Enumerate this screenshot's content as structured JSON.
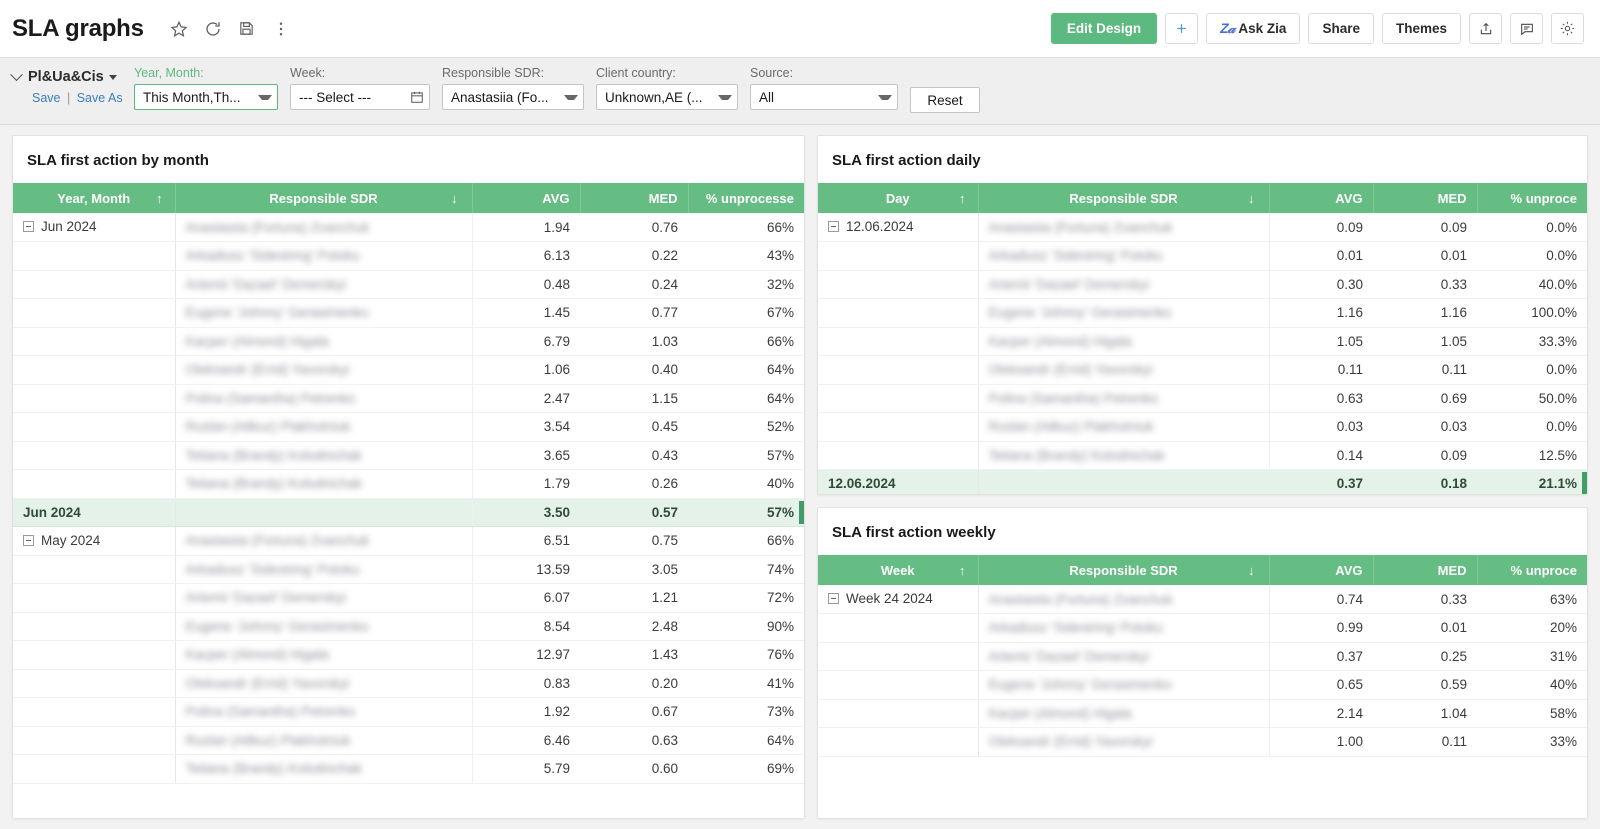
{
  "header": {
    "title": "SLA graphs",
    "title_icons": [
      {
        "name": "favorite-star-icon",
        "glyph": "star"
      },
      {
        "name": "refresh-icon",
        "glyph": "refresh"
      },
      {
        "name": "save-disk-icon",
        "glyph": "disk"
      },
      {
        "name": "more-options-icon",
        "glyph": "kebab"
      }
    ],
    "buttons": [
      {
        "name": "edit-design-button",
        "label": "Edit Design",
        "style": "primary"
      },
      {
        "name": "add-button",
        "label": "+",
        "style": "icon"
      },
      {
        "name": "ask-zia-button",
        "label": "Ask Zia",
        "style": "zia"
      },
      {
        "name": "share-button",
        "label": "Share",
        "style": "default"
      },
      {
        "name": "themes-button",
        "label": "Themes",
        "style": "default"
      },
      {
        "name": "export-button",
        "label": "",
        "style": "icon"
      },
      {
        "name": "comment-button",
        "label": "",
        "style": "icon"
      },
      {
        "name": "settings-button",
        "label": "",
        "style": "icon"
      }
    ]
  },
  "filterbar": {
    "view_name": "Pl&Ua&Cis",
    "save_label": "Save",
    "save_as_label": "Save As",
    "reset_label": "Reset",
    "filters": [
      {
        "name": "year-month",
        "label": "Year, Month:",
        "value": "This Month,Th...",
        "control": "select",
        "active": true
      },
      {
        "name": "week",
        "label": "Week:",
        "value": "--- Select ---",
        "control": "date",
        "active": false
      },
      {
        "name": "responsible-sdr",
        "label": "Responsible SDR:",
        "value": "Anastasiia (Fo...",
        "control": "select",
        "active": false
      },
      {
        "name": "client-country",
        "label": "Client country:",
        "value": "Unknown,AE (...",
        "control": "select",
        "active": false
      },
      {
        "name": "source",
        "label": "Source:",
        "value": "All",
        "control": "select",
        "active": false
      }
    ]
  },
  "colors": {
    "header_green": "#65bd83",
    "primary_green": "#5cb97f",
    "summary_row": "#e4f2e9",
    "summary_bar": "#3f9e63",
    "link_blue": "#3a7ec0",
    "canvas": "#f2f2f2"
  },
  "widgets": {
    "month": {
      "title": "SLA first action by month",
      "columns": [
        {
          "name": "year-month",
          "label": "Year, Month",
          "sort": "↑"
        },
        {
          "name": "responsible-sdr",
          "label": "Responsible SDR",
          "sort": "↓"
        },
        {
          "name": "avg",
          "label": "AVG"
        },
        {
          "name": "med",
          "label": "MED"
        },
        {
          "name": "pct-unprocessed",
          "label": "% unprocesse"
        }
      ],
      "groups": [
        {
          "label": "Jun 2024",
          "rows": [
            {
              "sdr": "Anastasiia (Fortuna) Zvanchuk",
              "avg": "1.94",
              "med": "0.76",
              "pct": "66%"
            },
            {
              "sdr": "Arkadiusz 'Sidestring' Potoku",
              "avg": "6.13",
              "med": "0.22",
              "pct": "43%"
            },
            {
              "sdr": "Artemii 'Dazael' Demerskyi",
              "avg": "0.48",
              "med": "0.24",
              "pct": "32%"
            },
            {
              "sdr": "Eugene 'Johnny' Gerasimenko",
              "avg": "1.45",
              "med": "0.77",
              "pct": "67%"
            },
            {
              "sdr": "Kacper (Almond) Higala",
              "avg": "6.79",
              "med": "1.03",
              "pct": "66%"
            },
            {
              "sdr": "Oleksandr (Errid) Yavorskyi",
              "avg": "1.06",
              "med": "0.40",
              "pct": "64%"
            },
            {
              "sdr": "Polina (Samantha) Petrenko",
              "avg": "2.47",
              "med": "1.15",
              "pct": "64%"
            },
            {
              "sdr": "Ruslan (Atlkuz) Plakhotniuk",
              "avg": "3.54",
              "med": "0.45",
              "pct": "52%"
            },
            {
              "sdr": "Tetiana (Brandy) Kolodnichak",
              "avg": "3.65",
              "med": "0.43",
              "pct": "57%"
            },
            {
              "sdr": "Tetiana (Brandy) Kolodnichak",
              "avg": "1.79",
              "med": "0.26",
              "pct": "40%"
            }
          ],
          "summary": {
            "label": "Jun 2024",
            "avg": "3.50",
            "med": "0.57",
            "pct": "57%"
          }
        },
        {
          "label": "May 2024",
          "rows": [
            {
              "sdr": "Anastasiia (Fortuna) Zvanchuk",
              "avg": "6.51",
              "med": "0.75",
              "pct": "66%"
            },
            {
              "sdr": "Arkadiusz 'Sidestring' Potoku",
              "avg": "13.59",
              "med": "3.05",
              "pct": "74%"
            },
            {
              "sdr": "Artemii 'Dazael' Demerskyi",
              "avg": "6.07",
              "med": "1.21",
              "pct": "72%"
            },
            {
              "sdr": "Eugene 'Johnny' Gerasimenko",
              "avg": "8.54",
              "med": "2.48",
              "pct": "90%"
            },
            {
              "sdr": "Kacper (Almond) Higala",
              "avg": "12.97",
              "med": "1.43",
              "pct": "76%"
            },
            {
              "sdr": "Oleksandr (Errid) Yavorskyi",
              "avg": "0.83",
              "med": "0.20",
              "pct": "41%"
            },
            {
              "sdr": "Polina (Samantha) Petrenko",
              "avg": "1.92",
              "med": "0.67",
              "pct": "73%"
            },
            {
              "sdr": "Ruslan (Atlkuz) Plakhotniuk",
              "avg": "6.46",
              "med": "0.63",
              "pct": "64%"
            },
            {
              "sdr": "Tetiana (Brandy) Kolodnichak",
              "avg": "5.79",
              "med": "0.60",
              "pct": "69%"
            }
          ],
          "summary": null
        }
      ]
    },
    "daily": {
      "title": "SLA first action daily",
      "columns": [
        {
          "name": "day",
          "label": "Day",
          "sort": "↑"
        },
        {
          "name": "responsible-sdr",
          "label": "Responsible SDR",
          "sort": "↓"
        },
        {
          "name": "avg",
          "label": "AVG"
        },
        {
          "name": "med",
          "label": "MED"
        },
        {
          "name": "pct-unprocessed",
          "label": "% unproce"
        }
      ],
      "groups": [
        {
          "label": "12.06.2024",
          "rows": [
            {
              "sdr": "Anastasiia (Fortuna) Zvanchuk",
              "avg": "0.09",
              "med": "0.09",
              "pct": "0.0%"
            },
            {
              "sdr": "Arkadiusz 'Sidestring' Potoku",
              "avg": "0.01",
              "med": "0.01",
              "pct": "0.0%"
            },
            {
              "sdr": "Artemii 'Dazael' Demerskyi",
              "avg": "0.30",
              "med": "0.33",
              "pct": "40.0%"
            },
            {
              "sdr": "Eugene 'Johnny' Gerasimenko",
              "avg": "1.16",
              "med": "1.16",
              "pct": "100.0%"
            },
            {
              "sdr": "Kacper (Almond) Higala",
              "avg": "1.05",
              "med": "1.05",
              "pct": "33.3%"
            },
            {
              "sdr": "Oleksandr (Errid) Yavorskyi",
              "avg": "0.11",
              "med": "0.11",
              "pct": "0.0%"
            },
            {
              "sdr": "Polina (Samantha) Petrenko",
              "avg": "0.63",
              "med": "0.69",
              "pct": "50.0%"
            },
            {
              "sdr": "Ruslan (Atlkuz) Plakhotniuk",
              "avg": "0.03",
              "med": "0.03",
              "pct": "0.0%"
            },
            {
              "sdr": "Tetiana (Brandy) Kolodnichak",
              "avg": "0.14",
              "med": "0.09",
              "pct": "12.5%"
            }
          ],
          "summary": {
            "label": "12.06.2024",
            "avg": "0.37",
            "med": "0.18",
            "pct": "21.1%"
          }
        }
      ]
    },
    "weekly": {
      "title": "SLA first action weekly",
      "columns": [
        {
          "name": "week",
          "label": "Week",
          "sort": "↑"
        },
        {
          "name": "responsible-sdr",
          "label": "Responsible SDR",
          "sort": "↓"
        },
        {
          "name": "avg",
          "label": "AVG"
        },
        {
          "name": "med",
          "label": "MED"
        },
        {
          "name": "pct-unprocessed",
          "label": "% unproce"
        }
      ],
      "groups": [
        {
          "label": "Week 24 2024",
          "rows": [
            {
              "sdr": "Anastasiia (Fortuna) Zvanchuk",
              "avg": "0.74",
              "med": "0.33",
              "pct": "63%"
            },
            {
              "sdr": "Arkadiusz 'Sidestring' Potoku",
              "avg": "0.99",
              "med": "0.01",
              "pct": "20%"
            },
            {
              "sdr": "Artemii 'Dazael' Demerskyi",
              "avg": "0.37",
              "med": "0.25",
              "pct": "31%"
            },
            {
              "sdr": "Eugene 'Johnny' Gerasimenko",
              "avg": "0.65",
              "med": "0.59",
              "pct": "40%"
            },
            {
              "sdr": "Kacper (Almond) Higala",
              "avg": "2.14",
              "med": "1.04",
              "pct": "58%"
            },
            {
              "sdr": "Oleksandr (Errid) Yavorskyi",
              "avg": "1.00",
              "med": "0.11",
              "pct": "33%"
            }
          ],
          "summary": null
        }
      ]
    }
  }
}
